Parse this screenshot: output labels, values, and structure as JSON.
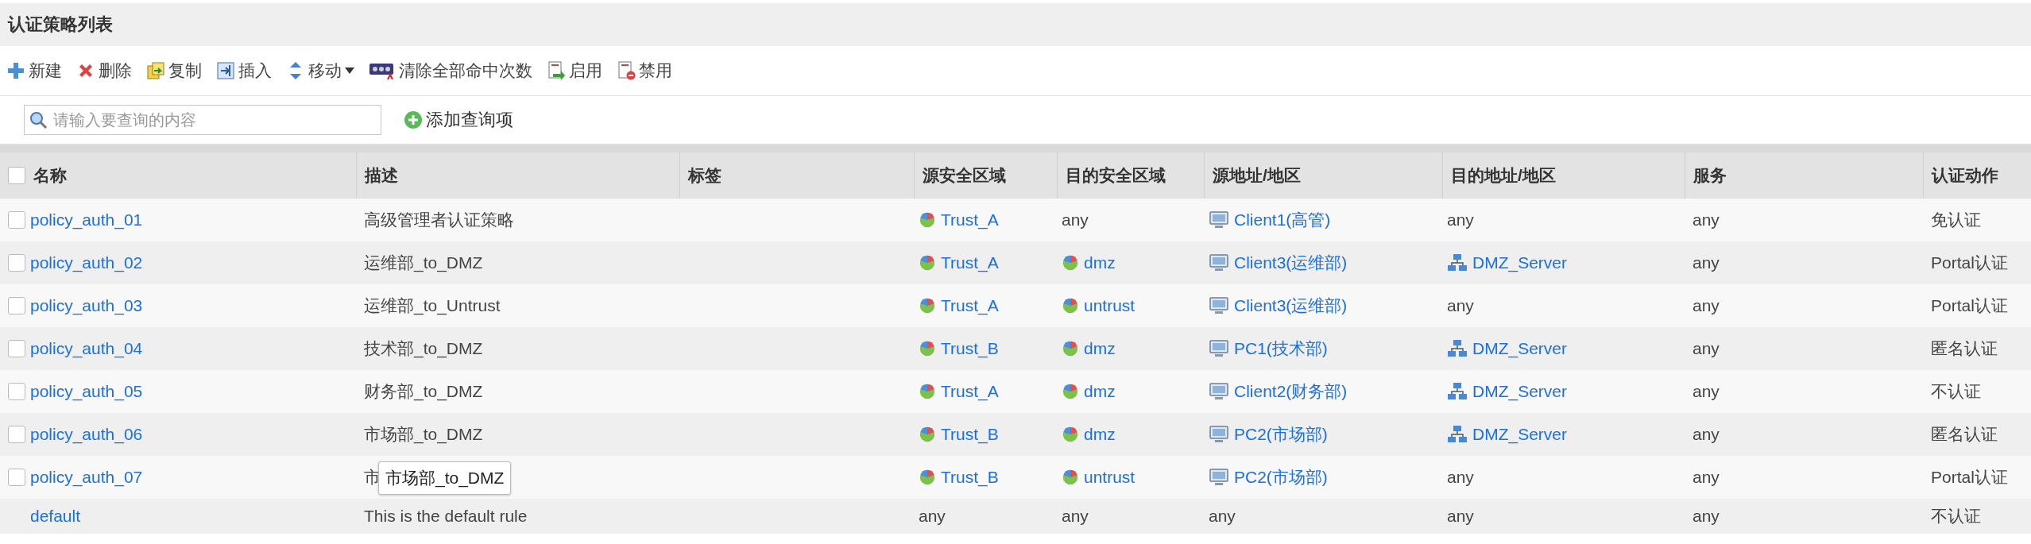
{
  "panel_title": "认证策略列表",
  "toolbar": [
    {
      "kind": "new",
      "label": "新建"
    },
    {
      "kind": "delete",
      "label": "删除"
    },
    {
      "kind": "copy",
      "label": "复制"
    },
    {
      "kind": "insert",
      "label": "插入"
    },
    {
      "kind": "move",
      "label": "移动",
      "has_menu": true
    },
    {
      "kind": "clear",
      "label": "清除全部命中次数"
    },
    {
      "kind": "enable",
      "label": "启用"
    },
    {
      "kind": "disable",
      "label": "禁用"
    }
  ],
  "search": {
    "placeholder": "请输入要查询的内容",
    "add_label": "添加查询项"
  },
  "table": {
    "select_all_checked": false,
    "columns": [
      "名称",
      "描述",
      "标签",
      "源安全区域",
      "目的安全区域",
      "源地址/地区",
      "目的地址/地区",
      "服务",
      "认证动作"
    ],
    "rows": [
      {
        "checkbox": true,
        "checked": false,
        "name": "policy_auth_01",
        "description": "高级管理者认证策略",
        "src_zone": {
          "kind": "zone",
          "text": "Trust_A"
        },
        "dst_zone": {
          "kind": "plain",
          "text": "any"
        },
        "src_addr": {
          "kind": "host",
          "text": "Client1(高管)"
        },
        "dst_addr": {
          "kind": "plain",
          "text": "any"
        },
        "service": "any",
        "action": "免认证"
      },
      {
        "checkbox": true,
        "checked": false,
        "name": "policy_auth_02",
        "description": "运维部_to_DMZ",
        "src_zone": {
          "kind": "zone",
          "text": "Trust_A"
        },
        "dst_zone": {
          "kind": "zone",
          "text": "dmz"
        },
        "src_addr": {
          "kind": "host",
          "text": "Client3(运维部)"
        },
        "dst_addr": {
          "kind": "server",
          "text": "DMZ_Server"
        },
        "service": "any",
        "action": "Portal认证"
      },
      {
        "checkbox": true,
        "checked": false,
        "name": "policy_auth_03",
        "description": "运维部_to_Untrust",
        "src_zone": {
          "kind": "zone",
          "text": "Trust_A"
        },
        "dst_zone": {
          "kind": "zone",
          "text": "untrust"
        },
        "src_addr": {
          "kind": "host",
          "text": "Client3(运维部)"
        },
        "dst_addr": {
          "kind": "plain",
          "text": "any"
        },
        "service": "any",
        "action": "Portal认证"
      },
      {
        "checkbox": true,
        "checked": false,
        "name": "policy_auth_04",
        "description": "技术部_to_DMZ",
        "src_zone": {
          "kind": "zone",
          "text": "Trust_B"
        },
        "dst_zone": {
          "kind": "zone",
          "text": "dmz"
        },
        "src_addr": {
          "kind": "host",
          "text": "PC1(技术部)"
        },
        "dst_addr": {
          "kind": "server",
          "text": "DMZ_Server"
        },
        "service": "any",
        "action": "匿名认证"
      },
      {
        "checkbox": true,
        "checked": false,
        "name": "policy_auth_05",
        "description": "财务部_to_DMZ",
        "src_zone": {
          "kind": "zone",
          "text": "Trust_A"
        },
        "dst_zone": {
          "kind": "zone",
          "text": "dmz"
        },
        "src_addr": {
          "kind": "host",
          "text": "Client2(财务部)"
        },
        "dst_addr": {
          "kind": "server",
          "text": "DMZ_Server"
        },
        "service": "any",
        "action": "不认证"
      },
      {
        "checkbox": true,
        "checked": false,
        "name": "policy_auth_06",
        "description": "市场部_to_DMZ",
        "src_zone": {
          "kind": "zone",
          "text": "Trust_B"
        },
        "dst_zone": {
          "kind": "zone",
          "text": "dmz"
        },
        "src_addr": {
          "kind": "host",
          "text": "PC2(市场部)"
        },
        "dst_addr": {
          "kind": "server",
          "text": "DMZ_Server"
        },
        "service": "any",
        "action": "匿名认证"
      },
      {
        "checkbox": true,
        "checked": false,
        "name": "policy_auth_07",
        "description": "市",
        "tooltip": "市场部_to_DMZ",
        "src_zone": {
          "kind": "zone",
          "text": "Trust_B"
        },
        "dst_zone": {
          "kind": "zone",
          "text": "untrust"
        },
        "src_addr": {
          "kind": "host",
          "text": "PC2(市场部)"
        },
        "dst_addr": {
          "kind": "plain",
          "text": "any"
        },
        "service": "any",
        "action": "Portal认证"
      },
      {
        "checkbox": false,
        "name": "default",
        "description": "This is the default rule",
        "src_zone": {
          "kind": "plain",
          "text": "any"
        },
        "dst_zone": {
          "kind": "plain",
          "text": "any"
        },
        "src_addr": {
          "kind": "plain",
          "text": "any"
        },
        "dst_addr": {
          "kind": "plain",
          "text": "any"
        },
        "service": "any",
        "action": "不认证"
      }
    ]
  }
}
